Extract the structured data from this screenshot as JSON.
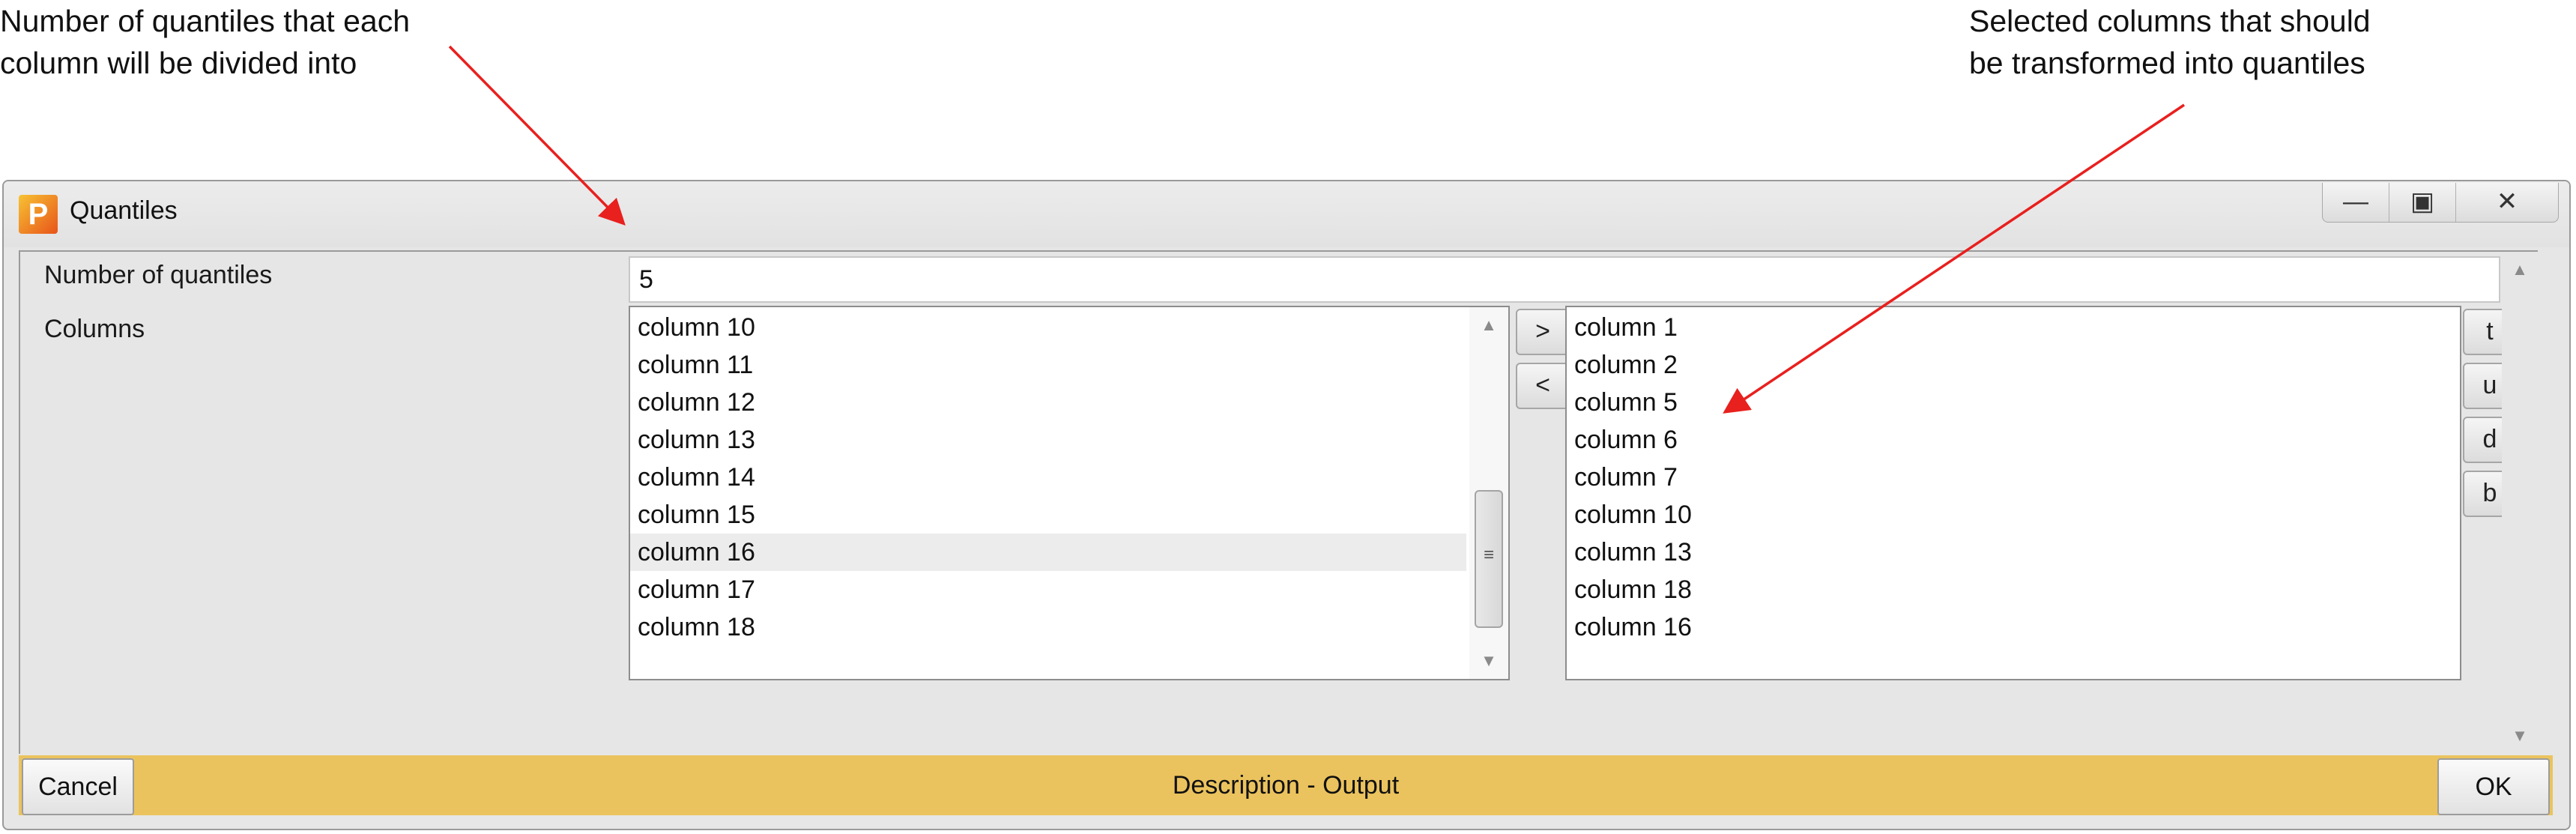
{
  "annotations": {
    "left": [
      "Number of quantiles that each",
      "column will be divided into"
    ],
    "right": [
      "Selected columns that should",
      "be transformed into quantiles"
    ],
    "arrow_color": "#e8201e"
  },
  "window": {
    "title": "Quantiles",
    "icon_letter": "P",
    "controls": {
      "minimize": "—",
      "maximize": "▣",
      "close": "✕"
    }
  },
  "form": {
    "quantiles_label": "Number of quantiles",
    "quantiles_value": "5",
    "columns_label": "Columns"
  },
  "available_columns": [
    "column 10",
    "column 11",
    "column 12",
    "column 13",
    "column 14",
    "column 15",
    "column 16",
    "column 17",
    "column 18"
  ],
  "selected_columns": [
    "column 1",
    "column 2",
    "column 5",
    "column 6",
    "column 7",
    "column 10",
    "column 13",
    "column 18",
    "column 16"
  ],
  "transfer_buttons": {
    "add": ">",
    "remove": "<"
  },
  "order_buttons": {
    "top": "t",
    "up": "u",
    "down": "d",
    "bottom": "b"
  },
  "scroll": {
    "up": "▲",
    "down": "▼",
    "grip": "≡"
  },
  "bottom": {
    "cancel": "Cancel",
    "status": "Description - Output",
    "ok": "OK",
    "bar_color": "#ebc35e"
  }
}
